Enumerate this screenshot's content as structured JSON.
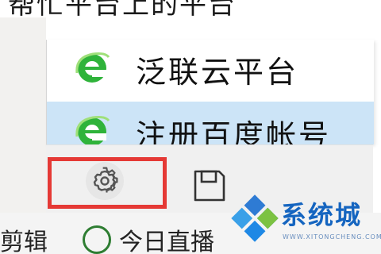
{
  "header": {
    "partial_text": "帮忙平台上的平台"
  },
  "menu": {
    "items": [
      {
        "label": "泛联云平台",
        "icon": "ie-browser-icon"
      },
      {
        "label": "注册百度帐号",
        "icon": "ie-browser-icon",
        "selected": true
      }
    ]
  },
  "toolbar": {
    "settings_icon": "gear-icon",
    "save_icon": "floppy-disk-icon"
  },
  "highlight": {
    "color": "#e53935"
  },
  "bottom": {
    "left_text": "剪辑",
    "mid_text": "今日直播"
  },
  "watermark": {
    "name": "系统城",
    "domain": "WWW.XITONGCHENG.COM"
  },
  "colors": {
    "selected_bg": "#cce4f7",
    "toolbar_bg": "#f0f0f0",
    "brand": "#1565c0"
  }
}
